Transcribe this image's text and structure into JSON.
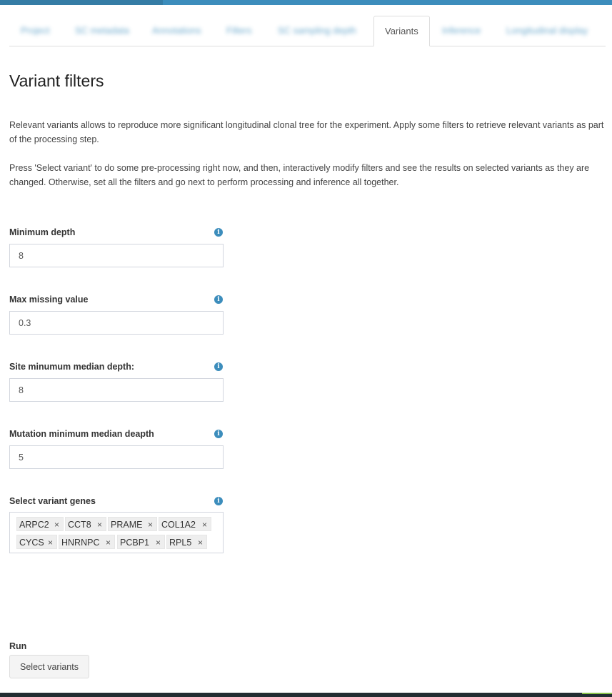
{
  "tabs": [
    {
      "label": "Project"
    },
    {
      "label": "SC metadata"
    },
    {
      "label": "Annotations"
    },
    {
      "label": "Filters"
    },
    {
      "label": "SC sampling depth"
    },
    {
      "label": "Variants"
    },
    {
      "label": "Inference"
    },
    {
      "label": "Longitudinal display"
    }
  ],
  "active_tab": "Variants",
  "page_title": "Variant filters",
  "intro_1": "Relevant variants allows to reproduce more significant longitudinal clonal tree for the experiment. Apply some filters to retrieve relevant variants as part of the processing step.",
  "intro_2": "Press 'Select variant' to do some pre-processing right now, and then, interactively modify filters and see the results on selected variants as they are changed. Otherwise, set all the filters and go next to perform processing and inference all together.",
  "fields": {
    "min_depth": {
      "label": "Minimum depth",
      "value": "8"
    },
    "max_missing": {
      "label": "Max missing value",
      "value": "0.3"
    },
    "site_depth": {
      "label": "Site minumum median depth:",
      "value": "8"
    },
    "mutation_depth": {
      "label": "Mutation minimum median deapth",
      "value": "5"
    }
  },
  "genes": {
    "label": "Select variant genes",
    "selected": [
      "ARPC2",
      "CCT8",
      "PRAME",
      "COL1A2",
      "CYCS",
      "HNRNPC",
      "PCBP1",
      "RPL5"
    ],
    "remove_glyph": "×"
  },
  "info_glyph": "i",
  "run": {
    "label": "Run",
    "button": "Select variants"
  },
  "colors": {
    "accent": "#3c8dbc",
    "footer": "#222d32"
  }
}
